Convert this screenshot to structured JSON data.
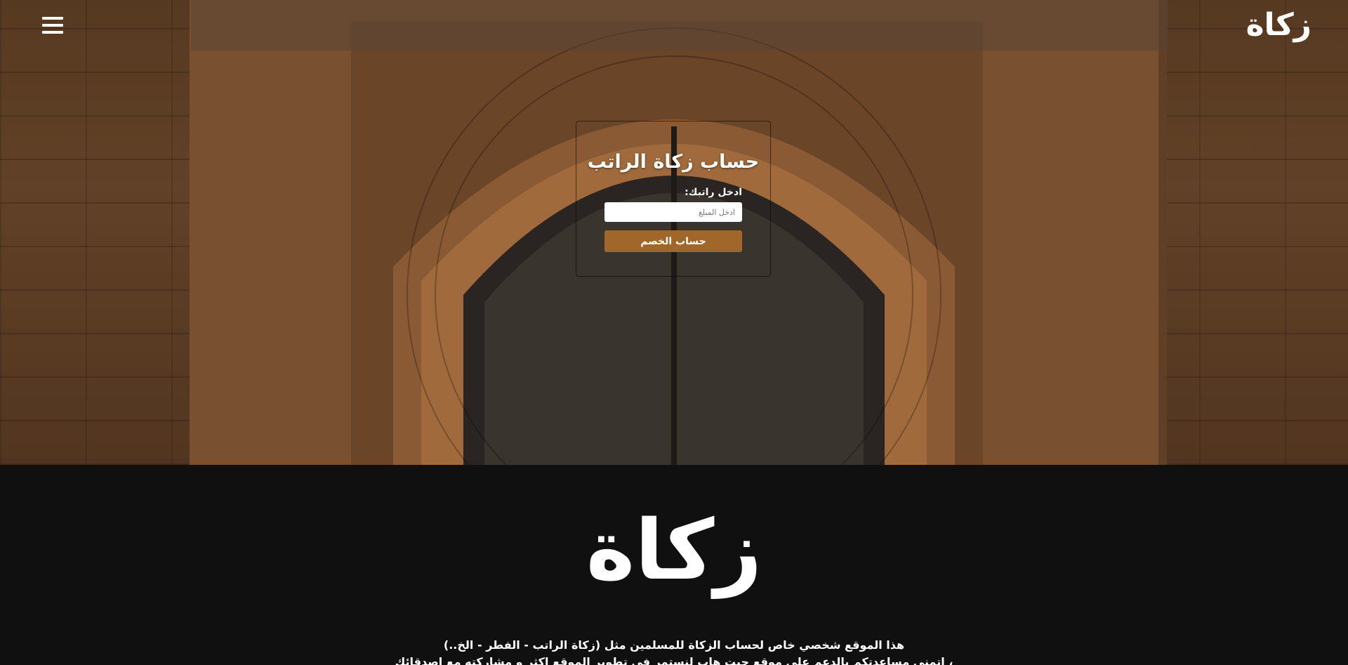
{
  "header": {
    "logo_text": "زكاة",
    "menu_icon": "hamburger-menu-icon"
  },
  "calculator": {
    "title": "حساب زكاة الراتب",
    "salary_label": "ادخل راتبك:",
    "amount_placeholder": "ادخل المبلغ",
    "submit_label": "حساب الخصم"
  },
  "footer": {
    "logo_text": "زكاة",
    "description_line1": "هذا الموقع شخصي خاص لحساب الزكاة للمسلمين مثل (زكاة الراتب - الفطر - الخ..)",
    "description_line2": "، اتمنى مساعدتكم بالدعم على موقع جيت هاب لنستمر في تطوير الموقع اكثر و مشاركته مع اصدقائك"
  },
  "colors": {
    "accent": "#a1672a",
    "footer_bg": "#101010"
  }
}
